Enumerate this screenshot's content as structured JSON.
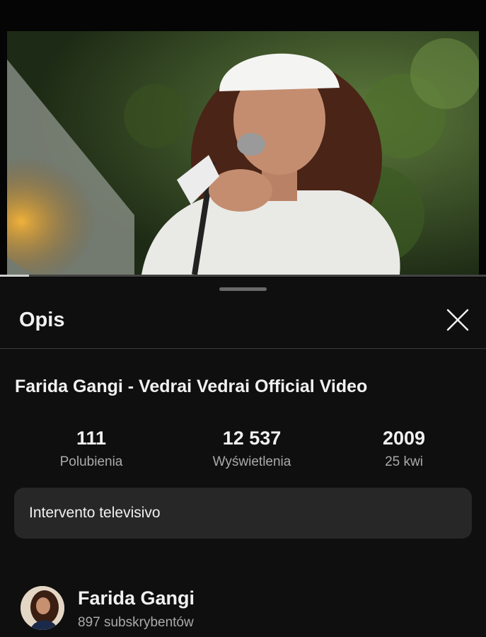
{
  "video": {
    "progress_fraction": 0.06
  },
  "sheet": {
    "title": "Opis",
    "close_icon": "close-icon"
  },
  "video_title": "Farida Gangi - Vedrai Vedrai Official Video",
  "stats": [
    {
      "value": "111",
      "label": "Polubienia"
    },
    {
      "value": "12 537",
      "label": "Wyświetlenia"
    },
    {
      "value": "2009",
      "label": "25 kwi"
    }
  ],
  "description": "Intervento televisivo",
  "channel": {
    "name": "Farida Gangi",
    "subscribers": "897 subskrybentów"
  },
  "colors": {
    "background": "#0f0f0f",
    "surface": "#272727",
    "text_primary": "#f1f1f1",
    "text_secondary": "#aaaaaa"
  }
}
